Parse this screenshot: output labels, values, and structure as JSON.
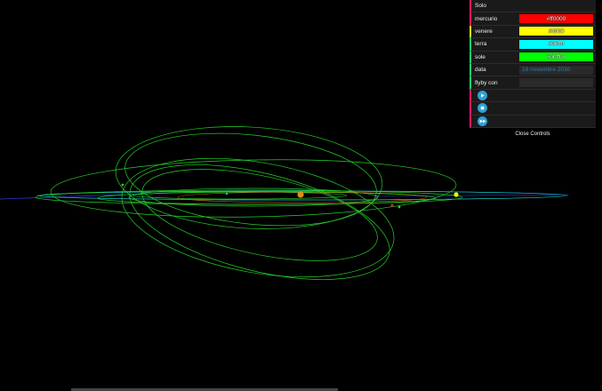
{
  "gui": {
    "rows": [
      {
        "label": "Solo",
        "type": "label",
        "accent": "#e61d5f"
      },
      {
        "label": "mercurio",
        "type": "color",
        "value": "#ff0000",
        "color": "#ff0000",
        "accent": "#e61d5f"
      },
      {
        "label": "venere",
        "type": "color",
        "value": "#ffff00",
        "color": "#ffff00",
        "accent": "#e6e61d"
      },
      {
        "label": "terra",
        "type": "color",
        "value": "#00ffff",
        "color": "#00ffff",
        "accent": "#1ed36f"
      },
      {
        "label": "sole",
        "type": "color",
        "value": "#00ff00",
        "color": "#00ff00",
        "accent": "#1ed36f"
      },
      {
        "label": "data",
        "type": "text",
        "value": "18 novembre 2030",
        "accent": "#1ed36f"
      },
      {
        "label": "flyby con",
        "type": "text",
        "value": "",
        "accent": "#1ed36f"
      }
    ],
    "buttons": [
      {
        "icon": "play-icon"
      },
      {
        "icon": "stop-icon"
      },
      {
        "icon": "fast-forward-icon"
      }
    ],
    "close_label": "Close Controls"
  },
  "colors": {
    "orbit_green": "#27d12a",
    "orbit_cyan": "#15c8c8",
    "sun": "#e58a17",
    "venus": "#f6f600",
    "earth_marker": "#d62020",
    "ecliptic": "#2a3bd0"
  }
}
